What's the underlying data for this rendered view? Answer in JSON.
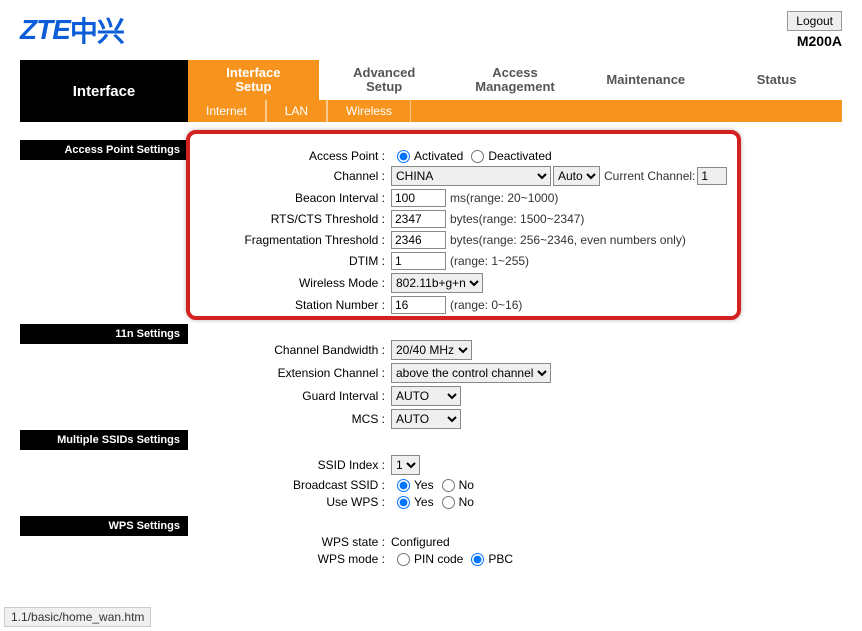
{
  "header": {
    "logout": "Logout",
    "model": "M200A",
    "logo_a": "ZTE",
    "logo_b": "中兴"
  },
  "nav": {
    "side": "Interface",
    "tabs": [
      "Interface\nSetup",
      "Advanced\nSetup",
      "Access\nManagement",
      "Maintenance",
      "Status"
    ],
    "subtabs": [
      "Internet",
      "LAN",
      "Wireless"
    ]
  },
  "sections": {
    "ap": "Access Point Settings",
    "n11": "11n Settings",
    "ssid": "Multiple SSIDs Settings",
    "wps": "WPS Settings"
  },
  "ap": {
    "accessPointLabel": "Access Point :",
    "activated": "Activated",
    "deactivated": "Deactivated",
    "channelLabel": "Channel :",
    "channelVal": "CHINA",
    "auto": "Auto",
    "currentChannelLabel": "Current Channel:",
    "currentChannelVal": "1",
    "beaconLabel": "Beacon Interval :",
    "beaconVal": "100",
    "beaconHint": "ms(range: 20~1000)",
    "rtsLabel": "RTS/CTS Threshold :",
    "rtsVal": "2347",
    "rtsHint": "bytes(range: 1500~2347)",
    "fragLabel": "Fragmentation Threshold :",
    "fragVal": "2346",
    "fragHint": "bytes(range: 256~2346, even numbers only)",
    "dtimLabel": "DTIM :",
    "dtimVal": "1",
    "dtimHint": "(range: 1~255)",
    "wmodeLabel": "Wireless Mode :",
    "wmodeVal": "802.11b+g+n",
    "stationLabel": "Station Number :",
    "stationVal": "16",
    "stationHint": "(range: 0~16)"
  },
  "n11": {
    "bwLabel": "Channel Bandwidth :",
    "bwVal": "20/40 MHz",
    "extLabel": "Extension Channel :",
    "extVal": "above the control channel",
    "giLabel": "Guard Interval :",
    "giVal": "AUTO",
    "mcsLabel": "MCS :",
    "mcsVal": "AUTO"
  },
  "ssid": {
    "indexLabel": "SSID Index :",
    "indexVal": "1",
    "bcastLabel": "Broadcast SSID :",
    "yes": "Yes",
    "no": "No",
    "useWpsLabel": "Use WPS :"
  },
  "wps": {
    "stateLabel": "WPS state :",
    "stateVal": "Configured",
    "modeLabel": "WPS mode :",
    "pin": "PIN code",
    "pbc": "PBC"
  },
  "statusbar": "1.1/basic/home_wan.htm"
}
